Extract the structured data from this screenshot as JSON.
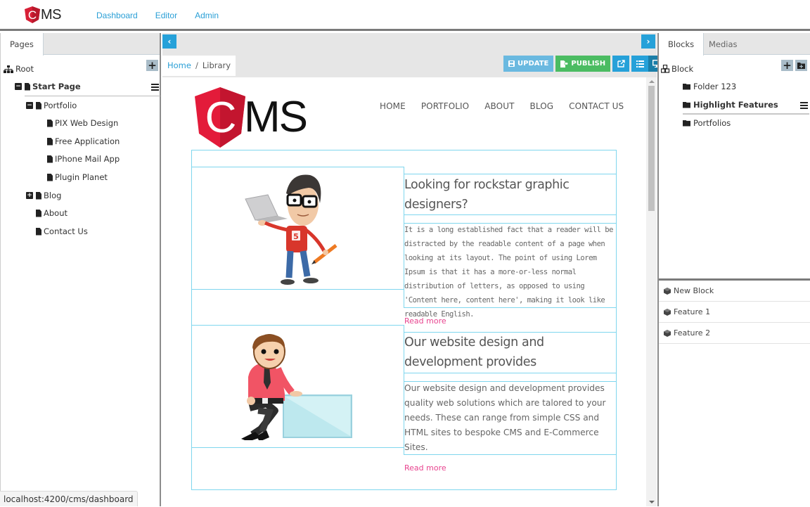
{
  "app": {
    "brand_letter": "C",
    "brand_text": "MS",
    "accent_color": "#26a1d9",
    "nav": [
      "Dashboard",
      "Editor",
      "Admin"
    ]
  },
  "left_panel": {
    "tabs": [
      "Pages"
    ],
    "root_label": "Root",
    "tree": [
      {
        "label": "Start Page",
        "level": 1,
        "toggle": "minus",
        "bold": true,
        "menu": true
      },
      {
        "label": "Portfolio",
        "level": 2,
        "toggle": "minus"
      },
      {
        "label": "PIX Web Design",
        "level": 3
      },
      {
        "label": "Free Application",
        "level": 3
      },
      {
        "label": "IPhone Mail App",
        "level": 3
      },
      {
        "label": "Plugin Planet",
        "level": 3
      },
      {
        "label": "Blog",
        "level": 2,
        "toggle": "plus"
      },
      {
        "label": "About",
        "level": 2
      },
      {
        "label": "Contact Us",
        "level": 2
      }
    ]
  },
  "center": {
    "breadcrumb": {
      "home": "Home",
      "separator": "/",
      "current": "Library"
    },
    "toolbar": {
      "update_label": "UPDATE",
      "publish_label": "PUBLISH",
      "update_color": "#6ab9e0",
      "publish_color": "#4bbc62"
    },
    "preview": {
      "logo_letter": "C",
      "logo_text": "MS",
      "nav": [
        "HOME",
        "PORTFOLIO",
        "ABOUT",
        "BLOG",
        "CONTACT US"
      ],
      "features": [
        {
          "title": "Looking for rockstar graphic designers?",
          "body": "It is a long established fact that a reader will be distracted by the readable content of a page when looking at its layout. The point of using Lorem Ipsum is that it has a more-or-less normal distribution of letters, as opposed to using 'Content here, content here', making it look like readable English.",
          "link": "Read more",
          "image": "developer-with-laptop-illustration"
        },
        {
          "title": "Our website design and development provides",
          "body": "Our website design and development provides quality web solutions which are talored to your needs. These can range from simple CSS and HTML sites to bespoke CMS and E-Commerce Sites.",
          "link": "Read more",
          "image": "businessman-with-board-illustration"
        }
      ],
      "link_color": "#e8448f",
      "outline_color": "#7fd6ee"
    }
  },
  "right_panel": {
    "tabs": [
      "Blocks",
      "Medias"
    ],
    "root_label": "Block",
    "folders": [
      {
        "label": "Folder 123",
        "bold": false
      },
      {
        "label": "Highlight Features",
        "bold": true,
        "menu": true
      },
      {
        "label": "Portfolios",
        "bold": false
      }
    ],
    "blocks": [
      "New Block",
      "Feature 1",
      "Feature 2"
    ]
  },
  "status_bar": {
    "url": "localhost:4200/cms/dashboard"
  }
}
